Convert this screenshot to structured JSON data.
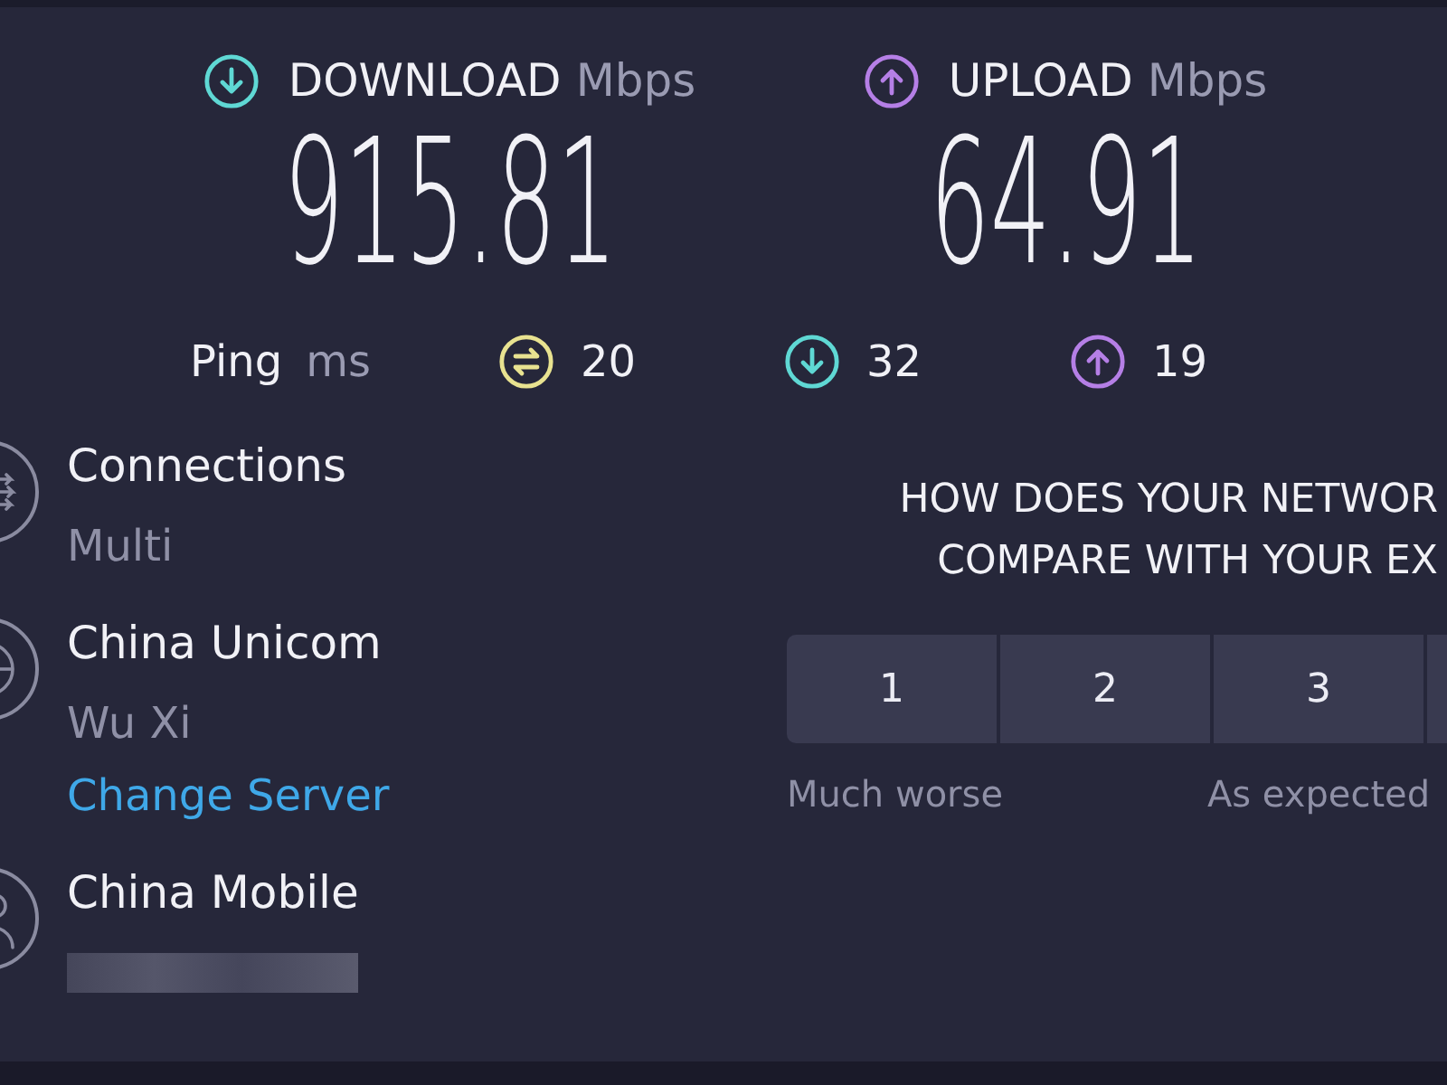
{
  "speeds": [
    {
      "kind": "download",
      "label": "DOWNLOAD",
      "unit": "Mbps",
      "value": "915.81"
    },
    {
      "kind": "upload",
      "label": "UPLOAD",
      "unit": "Mbps",
      "value": "64.91"
    }
  ],
  "ping": {
    "label": "Ping",
    "unit": "ms",
    "readings": [
      {
        "kind": "idle",
        "value": "20"
      },
      {
        "kind": "download",
        "value": "32"
      },
      {
        "kind": "upload",
        "value": "19"
      }
    ]
  },
  "servers": [
    {
      "kind": "connections",
      "title": "Connections",
      "subtitle": "Multi"
    },
    {
      "kind": "host",
      "title": "China Unicom",
      "subtitle": "Wu Xi",
      "link": "Change Server"
    },
    {
      "kind": "provider",
      "title": "China Mobile",
      "redacted": true
    }
  ],
  "survey": {
    "question": [
      "HOW DOES YOUR NETWOR",
      "COMPARE WITH YOUR EX"
    ],
    "options": [
      {
        "label": "1",
        "selected": false,
        "caption": "Much worse"
      },
      {
        "label": "2",
        "selected": false
      },
      {
        "label": "3",
        "selected": false,
        "caption": "As expected"
      },
      {
        "selected": false
      }
    ]
  }
}
